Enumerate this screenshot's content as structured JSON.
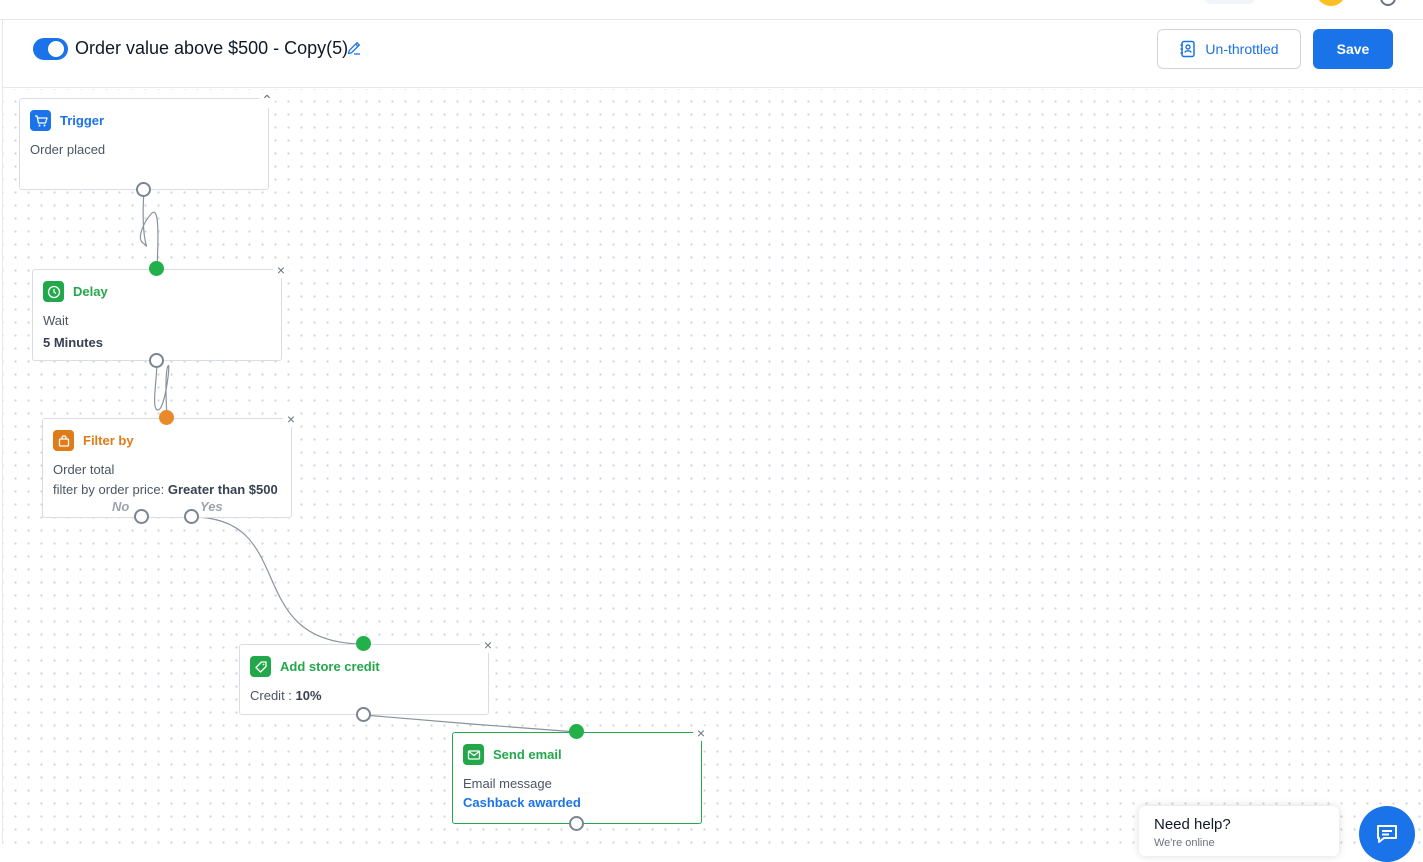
{
  "workflow": {
    "enabled": true,
    "title": "Order value above $500 - Copy(5)"
  },
  "header": {
    "throttle_label": "Un-throttled",
    "save_label": "Save"
  },
  "nodes": {
    "trigger": {
      "title": "Trigger",
      "line1": "Order placed",
      "color": "#1a73e8",
      "icon": "cart-icon"
    },
    "delay": {
      "title": "Delay",
      "line1": "Wait",
      "line2": "5 Minutes",
      "color": "#22a84a",
      "icon": "clock-icon"
    },
    "filter": {
      "title": "Filter by",
      "line1": "Order total",
      "line2_prefix": "filter by order price:",
      "line2_value": "Greater than $500",
      "branch_no": "No",
      "branch_yes": "Yes",
      "color": "#e07b1a",
      "icon": "shopping-bag-icon"
    },
    "credit": {
      "title": "Add store credit",
      "line1_prefix": "Credit :",
      "line1_value": "10%",
      "color": "#22a84a",
      "icon": "tag-icon"
    },
    "email": {
      "title": "Send email",
      "line1": "Email message",
      "line2": "Cashback awarded",
      "color": "#22a84a",
      "icon": "mail-icon"
    }
  },
  "help": {
    "title": "Need help?",
    "subtitle": "We're online"
  },
  "colors": {
    "primary": "#1a73e8",
    "success": "#22b04b",
    "warning": "#e8892b"
  }
}
